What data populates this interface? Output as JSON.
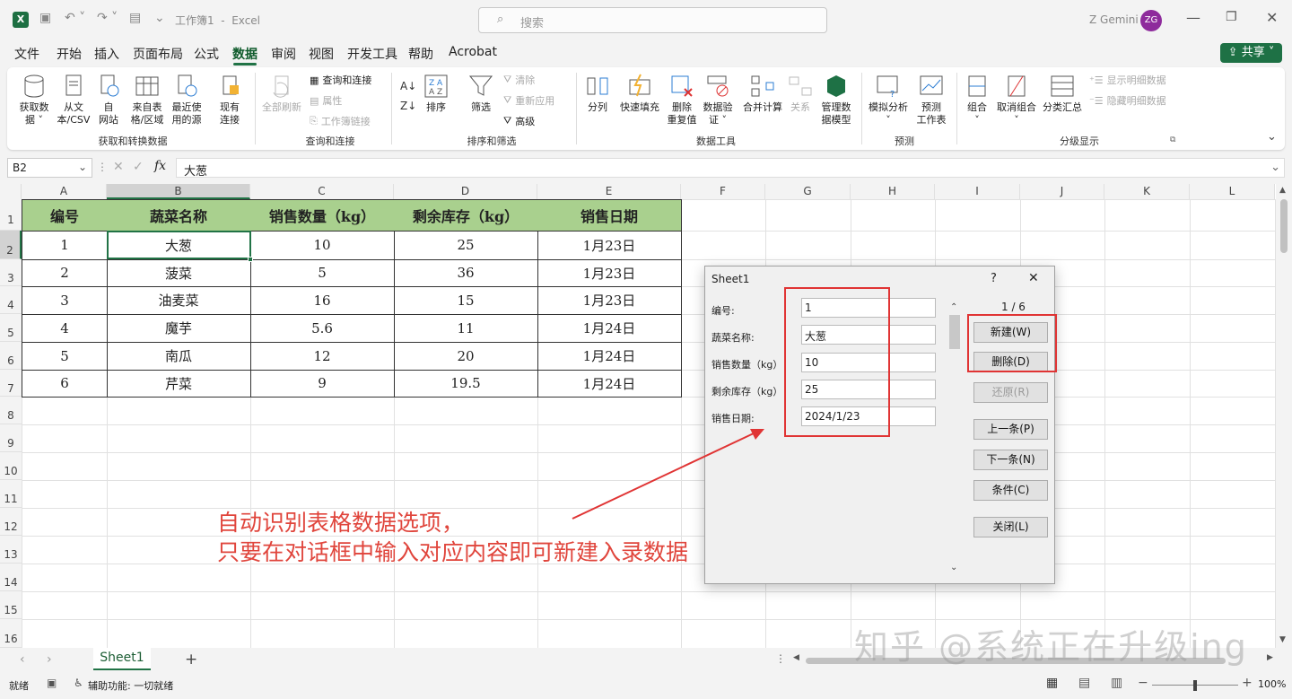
{
  "titlebar": {
    "doc_title": "工作簿1  -  Excel",
    "search_placeholder": "搜索",
    "user_name": "Z Gemini",
    "avatar_initials": "ZG",
    "share_label": "共享"
  },
  "menu": [
    "文件",
    "开始",
    "插入",
    "页面布局",
    "公式",
    "数据",
    "审阅",
    "视图",
    "开发工具",
    "帮助",
    "Acrobat"
  ],
  "ribbon": {
    "get_data": {
      "label": "获取数\n据 ˅",
      "from_text": "从文\n本/CSV",
      "from_web": "自\n网站",
      "from_table": "来自表\n格/区域",
      "recent": "最近使\n用的源",
      "existing": "现有\n连接",
      "group": "获取和转换数据"
    },
    "query": {
      "refresh": "全部刷新",
      "queries": "查询和连接",
      "props": "属性",
      "links": "工作簿链接",
      "group": "查询和连接"
    },
    "sort": {
      "sort_label": "排序",
      "filter": "筛选",
      "clear": "清除",
      "reapply": "重新应用",
      "advanced": "高级",
      "group": "排序和筛选"
    },
    "tools": {
      "split": "分列",
      "flash": "快速填充",
      "remove_dup": "删除\n重复值",
      "validate": "数据验\n证 ˅",
      "consolidate": "合并计算",
      "relations": "关系",
      "model": "管理数\n据模型",
      "group": "数据工具"
    },
    "forecast": {
      "whatif": "模拟分析\n˅",
      "sheet": "预测\n工作表",
      "group": "预测"
    },
    "outline": {
      "group_btn": "组合\n˅",
      "ungroup": "取消组合\n˅",
      "subtotal": "分类汇总",
      "show": "显示明细数据",
      "hide": "隐藏明细数据",
      "group": "分级显示"
    }
  },
  "formula_bar": {
    "name_box": "B2",
    "fx": "fx",
    "content": "大葱"
  },
  "columns": [
    "A",
    "B",
    "C",
    "D",
    "E",
    "F",
    "G",
    "H",
    "I",
    "J",
    "K",
    "L"
  ],
  "rows": [
    "1",
    "2",
    "3",
    "4",
    "5",
    "6",
    "7",
    "8",
    "9",
    "10",
    "11",
    "12",
    "13",
    "14",
    "15",
    "16"
  ],
  "table": {
    "headers": [
      "编号",
      "蔬菜名称",
      "销售数量（kg）",
      "剩余库存（kg）",
      "销售日期"
    ],
    "rows": [
      [
        "1",
        "大葱",
        "10",
        "25",
        "1月23日"
      ],
      [
        "2",
        "菠菜",
        "5",
        "36",
        "1月23日"
      ],
      [
        "3",
        "油麦菜",
        "16",
        "15",
        "1月23日"
      ],
      [
        "4",
        "魔芋",
        "5.6",
        "11",
        "1月24日"
      ],
      [
        "5",
        "南瓜",
        "12",
        "20",
        "1月24日"
      ],
      [
        "6",
        "芹菜",
        "9",
        "19.5",
        "1月24日"
      ]
    ]
  },
  "dialog": {
    "title": "Sheet1",
    "help": "?",
    "close": "✕",
    "record_counter": "1 / 6",
    "fields": [
      {
        "label": "编号:",
        "value": "1"
      },
      {
        "label": "蔬菜名称:",
        "value": "大葱"
      },
      {
        "label": "销售数量（kg）",
        "value": "10"
      },
      {
        "label": "剩余库存（kg）",
        "value": "25"
      },
      {
        "label": "销售日期:",
        "value": "2024/1/23"
      }
    ],
    "buttons": {
      "new": "新建(W)",
      "delete": "删除(D)",
      "restore": "还原(R)",
      "prev": "上一条(P)",
      "next": "下一条(N)",
      "criteria": "条件(C)",
      "close": "关闭(L)"
    }
  },
  "annotation": {
    "line1": "自动识别表格数据选项，",
    "line2": "只要在对话框中输入对应内容即可新建入录数据"
  },
  "watermark": "知乎 @系统正在升级ing",
  "sheet_tab": "Sheet1",
  "status": {
    "ready": "就绪",
    "accessibility": "辅助功能: 一切就绪",
    "zoom": "100%"
  }
}
